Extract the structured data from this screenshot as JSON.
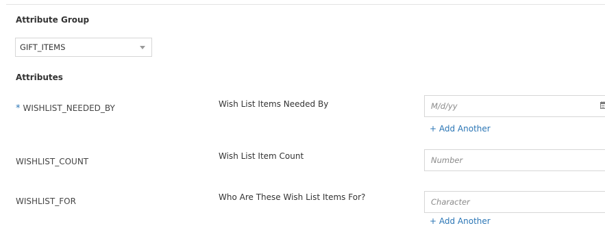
{
  "attribute_group": {
    "heading": "Attribute Group",
    "selected_value": "GIFT_ITEMS"
  },
  "attributes": {
    "heading": "Attributes",
    "required_marker": "*",
    "add_another_label": "+ Add Another",
    "rows": [
      {
        "name": "WISHLIST_NEEDED_BY",
        "display_name": "Wish List Items Needed By",
        "placeholder": "M/d/yy",
        "required": true,
        "icon": "calendar-icon"
      },
      {
        "name": "WISHLIST_COUNT",
        "display_name": "Wish List Item Count",
        "placeholder": "Number",
        "required": false
      },
      {
        "name": "WISHLIST_FOR",
        "display_name": "Who Are These Wish List Items For?",
        "placeholder": "Character",
        "required": false
      }
    ]
  },
  "colors": {
    "link": "#2a75b5",
    "border": "#d6d6d6",
    "text": "#333333",
    "placeholder": "#8a8a8a"
  }
}
